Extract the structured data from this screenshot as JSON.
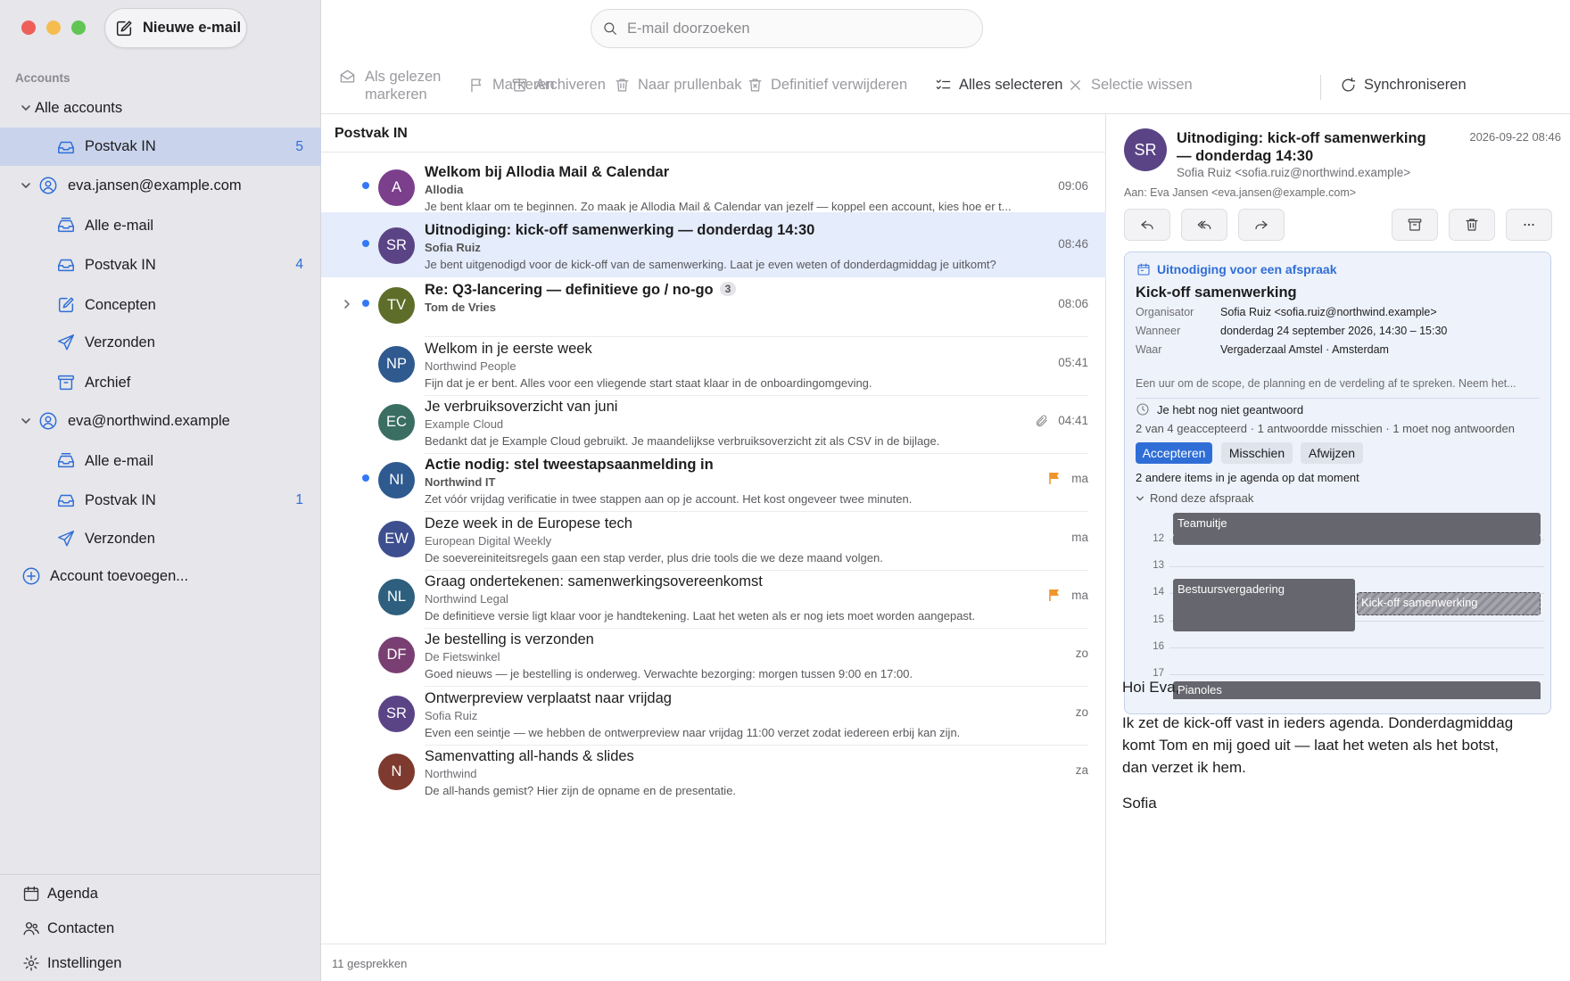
{
  "compose_label": "Nieuwe e-mail",
  "search_placeholder": "E-mail doorzoeken",
  "sidebar": {
    "accounts_label": "Accounts",
    "all_accounts": {
      "label": "Alle accounts",
      "inbox": {
        "label": "Postvak IN",
        "count": "5"
      }
    },
    "account1": {
      "label": "eva.jansen@example.com",
      "items": [
        {
          "label": "Alle e-mail",
          "count": ""
        },
        {
          "label": "Postvak IN",
          "count": "4"
        },
        {
          "label": "Concepten",
          "count": ""
        },
        {
          "label": "Verzonden",
          "count": ""
        },
        {
          "label": "Archief",
          "count": ""
        }
      ]
    },
    "account2": {
      "label": "eva@northwind.example",
      "items": [
        {
          "label": "Alle e-mail",
          "count": ""
        },
        {
          "label": "Postvak IN",
          "count": "1"
        },
        {
          "label": "Verzonden",
          "count": ""
        }
      ]
    },
    "add_account": "Account toevoegen...",
    "bottom": {
      "agenda": "Agenda",
      "contacts": "Contacten",
      "settings": "Instellingen"
    }
  },
  "toolbar": {
    "mark_read_1": "Als gelezen",
    "mark_read_2": "markeren",
    "flag": "Markeren",
    "archive": "Archiveren",
    "trash": "Naar prullenbak",
    "delete": "Definitief verwijderen",
    "select_all": "Alles selecteren",
    "clear_selection": "Selectie wissen",
    "sync": "Synchroniseren"
  },
  "list": {
    "title": "Postvak IN",
    "footer": "11 gesprekken",
    "messages": [
      {
        "initials": "A",
        "color": "#7b3f8c",
        "subject": "Welkom bij Allodia Mail & Calendar",
        "from": "Allodia",
        "preview": "Je bent klaar om te beginnen. Zo maak je Allodia Mail & Calendar van jezelf — koppel een account, kies hoe er t...",
        "time": "09:06",
        "unread": true
      },
      {
        "initials": "SR",
        "color": "#5a4486",
        "subject": "Uitnodiging: kick-off samenwerking — donderdag 14:30",
        "from": "Sofia Ruiz",
        "preview": "Je bent uitgenodigd voor de kick-off van de samenwerking. Laat je even weten of donderdagmiddag je uitkomt?",
        "time": "08:46",
        "unread": true
      },
      {
        "initials": "TV",
        "color": "#5e6e2a",
        "subject": "Re: Q3-lancering — definitieve go / no-go",
        "thread_count": "3",
        "from": "Tom de Vries",
        "preview": "",
        "time": "08:06",
        "unread": true
      },
      {
        "initials": "NP",
        "color": "#2f5a8f",
        "subject": "Welkom in je eerste week",
        "from": "Northwind People",
        "preview": "Fijn dat je er bent. Alles voor een vliegende start staat klaar in de onboardingomgeving.",
        "time": "05:41",
        "unread": false
      },
      {
        "initials": "EC",
        "color": "#3a6e62",
        "subject": "Je verbruiksoverzicht van juni",
        "from": "Example Cloud",
        "preview": "Bedankt dat je Example Cloud gebruikt. Je maandelijkse verbruiksoverzicht zit als CSV in de bijlage.",
        "time": "04:41",
        "unread": false
      },
      {
        "initials": "NI",
        "color": "#2f5a8f",
        "subject": "Actie nodig: stel tweestapsaanmelding in",
        "from": "Northwind IT",
        "preview": "Zet vóór vrijdag verificatie in twee stappen aan op je account. Het kost ongeveer twee minuten.",
        "time": "ma",
        "unread": true
      },
      {
        "initials": "EW",
        "color": "#3d4f8f",
        "subject": "Deze week in de Europese tech",
        "from": "European Digital Weekly",
        "preview": "De soevereiniteitsregels gaan een stap verder, plus drie tools die we deze maand volgen.",
        "time": "ma",
        "unread": false
      },
      {
        "initials": "NL",
        "color": "#2e5f7e",
        "subject": "Graag ondertekenen: samenwerkingsovereenkomst",
        "from": "Northwind Legal",
        "preview": "De definitieve versie ligt klaar voor je handtekening. Laat het weten als er nog iets moet worden aangepast.",
        "time": "ma",
        "unread": false
      },
      {
        "initials": "DF",
        "color": "#7a3f72",
        "subject": "Je bestelling is verzonden",
        "from": "De Fietswinkel",
        "preview": "Goed nieuws — je bestelling is onderweg. Verwachte bezorging: morgen tussen 9:00 en 17:00.",
        "time": "zo",
        "unread": false
      },
      {
        "initials": "SR",
        "color": "#5a4486",
        "subject": "Ontwerpreview verplaatst naar vrijdag",
        "from": "Sofia Ruiz",
        "preview": "Even een seintje — we hebben de ontwerpreview naar vrijdag 11:00 verzet zodat iedereen erbij kan zijn.",
        "time": "zo",
        "unread": false
      },
      {
        "initials": "N",
        "color": "#7e3a2e",
        "subject": "Samenvatting all-hands & slides",
        "from": "Northwind",
        "preview": "De all-hands gemist? Hier zijn de opname en de presentatie.",
        "time": "za",
        "unread": false
      }
    ]
  },
  "reading": {
    "initials": "SR",
    "subject": "Uitnodiging: kick-off samenwerking — donderdag 14:30",
    "date": "2026-09-22 08:46",
    "from": "Sofia Ruiz <sofia.ruiz@northwind.example>",
    "to": "Aan: Eva Jansen <eva.jansen@example.com>",
    "invite": {
      "header": "Uitnodiging voor een afspraak",
      "title": "Kick-off samenwerking",
      "organizer_label": "Organisator",
      "organizer": "Sofia Ruiz <sofia.ruiz@northwind.example>",
      "when_label": "Wanneer",
      "when": "donderdag 24 september 2026, 14:30 – 15:30",
      "where_label": "Waar",
      "where": "Vergaderzaal Amstel · Amsterdam",
      "description": "Een uur om de scope, de planning en de verdeling af te spreken. Neem het...",
      "response_status": "Je hebt nog niet geantwoord",
      "counts": "2 van 4 geaccepteerd · 1 antwoordde misschien · 1 moet nog antwoorden",
      "accept": "Accepteren",
      "maybe": "Misschien",
      "decline": "Afwijzen",
      "others": "2 andere items in je agenda op dat moment",
      "around": "Rond deze afspraak",
      "hours": [
        "12",
        "13",
        "14",
        "15",
        "16",
        "17"
      ],
      "events": {
        "team": "Teamuitje",
        "board": "Bestuursvergadering",
        "current": "Kick-off samenwerking",
        "pianoles": "Pianoles"
      }
    },
    "body": {
      "greeting": "Hoi Eva,",
      "paragraph": "Ik zet de kick-off vast in ieders agenda. Donderdagmiddag komt Tom en mij goed uit — laat het weten als het botst, dan verzet ik hem.",
      "signature": "Sofia"
    }
  },
  "colors": {
    "accent": "#2f6ed6",
    "selected_row": "#c9d4ec",
    "unread_dot": "#3478f6",
    "flag": "#f0952b"
  }
}
